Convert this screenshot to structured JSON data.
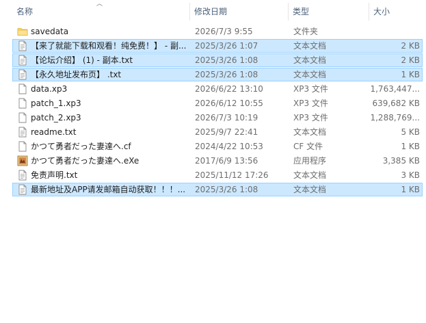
{
  "header": {
    "name": "名称",
    "date": "修改日期",
    "type": "类型",
    "size": "大小"
  },
  "files": [
    {
      "name": "savedata",
      "date": "2026/7/3 9:55",
      "type": "文件夹",
      "size": "",
      "icon": "folder-icon",
      "selected": false
    },
    {
      "name": "【来了就能下载和观看！纯免费！】 - 副...",
      "date": "2025/3/26 1:07",
      "type": "文本文档",
      "size": "2 KB",
      "icon": "text-file-icon",
      "selected": true
    },
    {
      "name": "【论坛介绍】 (1) - 副本.txt",
      "date": "2025/3/26 1:08",
      "type": "文本文档",
      "size": "2 KB",
      "icon": "text-file-icon",
      "selected": true
    },
    {
      "name": "【永久地址发布页】 .txt",
      "date": "2025/3/26 1:08",
      "type": "文本文档",
      "size": "1 KB",
      "icon": "text-file-icon",
      "selected": true
    },
    {
      "name": "data.xp3",
      "date": "2026/6/22 13:10",
      "type": "XP3 文件",
      "size": "1,763,447...",
      "icon": "blank-file-icon",
      "selected": false
    },
    {
      "name": "patch_1.xp3",
      "date": "2026/6/12 10:55",
      "type": "XP3 文件",
      "size": "639,682 KB",
      "icon": "blank-file-icon",
      "selected": false
    },
    {
      "name": "patch_2.xp3",
      "date": "2026/7/3 10:19",
      "type": "XP3 文件",
      "size": "1,288,769...",
      "icon": "blank-file-icon",
      "selected": false
    },
    {
      "name": "readme.txt",
      "date": "2025/9/7 22:41",
      "type": "文本文档",
      "size": "5 KB",
      "icon": "text-file-icon",
      "selected": false
    },
    {
      "name": "かつて勇者だった妻達へ.cf",
      "date": "2024/4/22 10:53",
      "type": "CF 文件",
      "size": "1 KB",
      "icon": "blank-file-icon",
      "selected": false
    },
    {
      "name": "かつて勇者だった妻達へ.eXe",
      "date": "2017/6/9 13:56",
      "type": "应用程序",
      "size": "3,385 KB",
      "icon": "app-icon",
      "selected": false
    },
    {
      "name": "免责声明.txt",
      "date": "2025/11/12 17:26",
      "type": "文本文档",
      "size": "3 KB",
      "icon": "text-file-icon",
      "selected": false
    },
    {
      "name": "最新地址及APP请发邮箱自动获取！！！...",
      "date": "2025/3/26 1:08",
      "type": "文本文档",
      "size": "1 KB",
      "icon": "text-file-icon",
      "selected": true
    }
  ]
}
